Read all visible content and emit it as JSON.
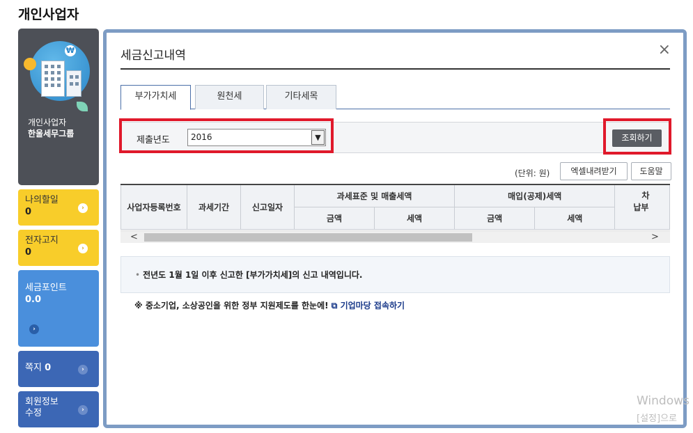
{
  "page_title": "개인사업자",
  "profile": {
    "line1": "개인사업자",
    "line2": "한울세무그룹"
  },
  "sidebar": {
    "todo": {
      "label": "나의할일",
      "count": "0"
    },
    "notice": {
      "label": "전자고지",
      "count": "0"
    },
    "points": {
      "label": "세금포인트",
      "value": "0.0"
    },
    "message": {
      "label": "쪽지",
      "count": "0"
    },
    "member": {
      "line1": "회원정보",
      "line2": "수정"
    }
  },
  "dialog": {
    "title": "세금신고내역",
    "close": "×",
    "tabs": [
      "부가가치세",
      "원천세",
      "기타세목"
    ],
    "filter": {
      "label": "제출년도",
      "year": "2016"
    },
    "search_button": "조회하기",
    "unit": "(단위: 원)",
    "excel_button": "엑셀내려받기",
    "help_button": "도움말",
    "table": {
      "headers": [
        "사업자등록번호",
        "과세기간",
        "신고일자",
        "과세표준 및 매출세액",
        "매입(공제)세액",
        "차",
        "납부"
      ],
      "subheaders": [
        "금액",
        "세액",
        "금액",
        "세액"
      ]
    },
    "notice_text": "전년도 1월 1일 이후 신고한 [부가가치세]의 신고 내역입니다.",
    "promo_text": "※ 중소기업, 소상공인을 위한 정부 지원제도를 한눈에!",
    "promo_link": "기업마당 접속하기"
  },
  "watermark": {
    "line1": "Windows",
    "line2": "[설정]으로"
  }
}
